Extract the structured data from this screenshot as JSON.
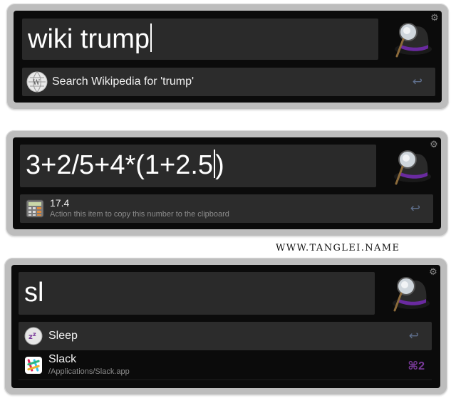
{
  "panels": [
    {
      "query": "wiki trump",
      "results": [
        {
          "title": "Search Wikipedia for 'trump'",
          "subtitle": "",
          "icon": "wikipedia-globe-icon",
          "hint": "↩"
        }
      ]
    },
    {
      "query": "3+2/5+4*(1+2.5",
      "query_after_caret": ")",
      "results": [
        {
          "title": "17.4",
          "subtitle": "Action this item to copy this number to the clipboard",
          "icon": "calculator-icon",
          "hint": "↩"
        }
      ]
    },
    {
      "query": "sl",
      "results": [
        {
          "title": "Sleep",
          "subtitle": "",
          "icon": "sleep-icon",
          "hint": "↩"
        },
        {
          "title": "Slack",
          "subtitle": "/Applications/Slack.app",
          "icon": "slack-icon",
          "hint": "⌘2"
        }
      ]
    }
  ],
  "watermark": "WWW.TANGLEI.NAME",
  "icons": {
    "settings": "gear-icon",
    "app": "alfred-hat-icon"
  },
  "colors": {
    "panel_frame": "#bdbdbd",
    "window_bg": "#0b0b0b",
    "field_bg": "#2a2a2a",
    "selected_row": "#2c2c2c",
    "shortcut": "#7a3a9a"
  }
}
